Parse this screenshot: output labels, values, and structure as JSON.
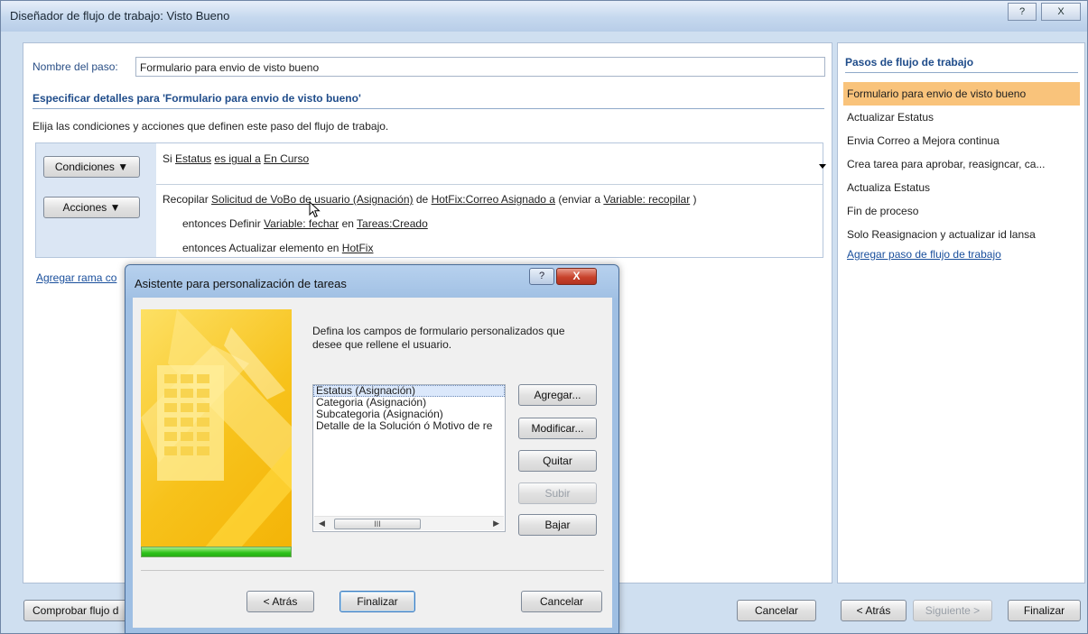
{
  "window": {
    "title": "Diseñador de flujo de trabajo: Visto Bueno",
    "help_glyph": "?",
    "close_glyph": "X"
  },
  "step_form": {
    "name_label": "Nombre del paso:",
    "name_value": "Formulario para envio de visto bueno",
    "section_heading": "Especificar detalles para 'Formulario para envio de visto bueno'",
    "description": "Elija las condiciones y acciones que definen este paso del flujo de trabajo.",
    "conditions_button": "Condiciones ▼",
    "actions_button": "Acciones ▼",
    "condition": {
      "prefix": "Si",
      "field": "Estatus",
      "operator": "es igual a",
      "value": "En Curso"
    },
    "action1": {
      "prefix": "Recopilar",
      "task": "Solicitud de VoBo de usuario (Asignación)",
      "from_word": "de",
      "from_value": "HotFix:Correo Asignado a",
      "send_text": "(enviar a",
      "variable": "Variable: recopilar",
      "close": ")"
    },
    "action2": {
      "prefix": "entonces Definir",
      "variable": "Variable: fechar",
      "in_word": "en",
      "value": "Tareas:Creado"
    },
    "action3": {
      "prefix": "entonces Actualizar elemento en",
      "list": "HotFix"
    },
    "add_branch_link": "Agregar rama co"
  },
  "steps_panel": {
    "heading": "Pasos de flujo de trabajo",
    "items": [
      "Formulario para envio de visto bueno",
      "Actualizar Estatus",
      "Envia Correo a Mejora continua",
      "Crea tarea para aprobar, reasigncar, ca...",
      "Actualiza Estatus",
      "Fin de proceso",
      "Solo Reasignacion y actualizar id lansa"
    ],
    "add_step_link": "Agregar paso de flujo de trabajo"
  },
  "bottom_bar": {
    "check_button": "Comprobar flujo d",
    "cancel_button": "Cancelar",
    "back_button": "< Atrás",
    "next_button": "Siguiente >",
    "finish_button": "Finalizar"
  },
  "wizard": {
    "title": "Asistente para personalización de tareas",
    "help_glyph": "?",
    "close_glyph": "X",
    "instructions": "Defina los campos de formulario personalizados que desee que rellene el usuario.",
    "fields": [
      "Estatus (Asignación)",
      "Categoria (Asignación)",
      "Subcategoria (Asignación)",
      "Detalle de la Solución ó Motivo de re"
    ],
    "scroll_thumb": "III",
    "add_button": "Agregar...",
    "modify_button": "Modificar...",
    "remove_button": "Quitar",
    "up_button": "Subir",
    "down_button": "Bajar",
    "back_button": "< Atrás",
    "finish_button": "Finalizar",
    "cancel_button": "Cancelar"
  },
  "colors": {
    "selected_step": "#f9c37b",
    "heading_blue": "#1f4c8a",
    "link_blue": "#1a4f9c",
    "close_red": "#c8432c",
    "progress_green": "#2ec21b",
    "art_yellow": "#f7c21b"
  }
}
